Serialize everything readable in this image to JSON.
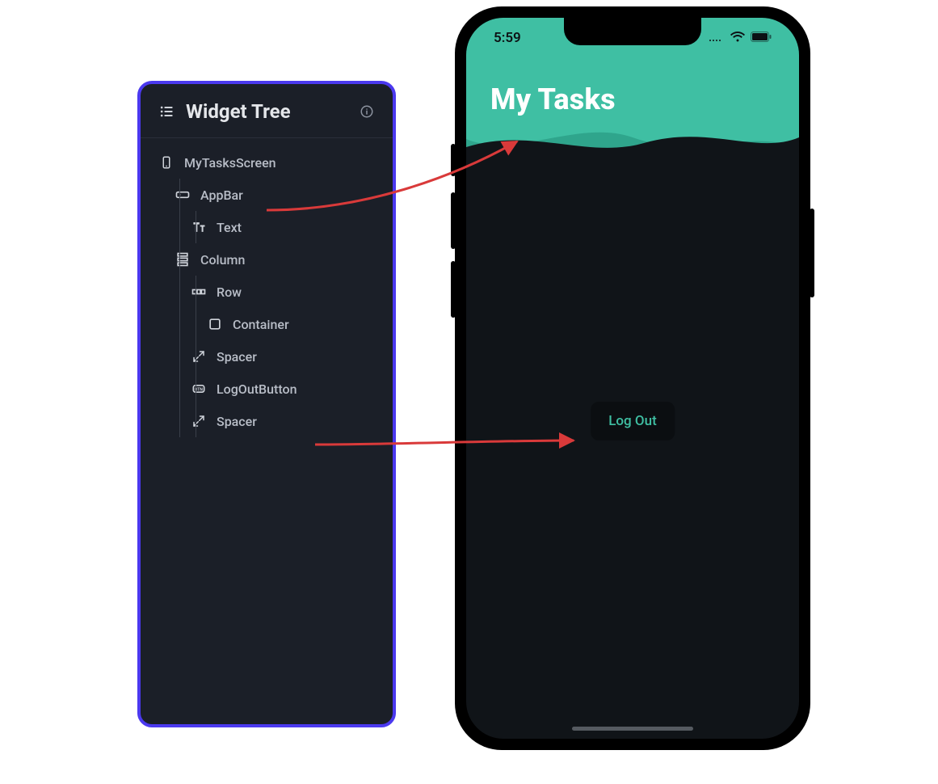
{
  "tree": {
    "title": "Widget Tree",
    "root": "MyTasksScreen",
    "items": {
      "appbar": "AppBar",
      "text": "Text",
      "column": "Column",
      "row": "Row",
      "container": "Container",
      "spacer1": "Spacer",
      "logout": "LogOutButton",
      "spacer2": "Spacer"
    }
  },
  "phone": {
    "time": "5:59",
    "app_title": "My Tasks",
    "logout_label": "Log Out"
  }
}
